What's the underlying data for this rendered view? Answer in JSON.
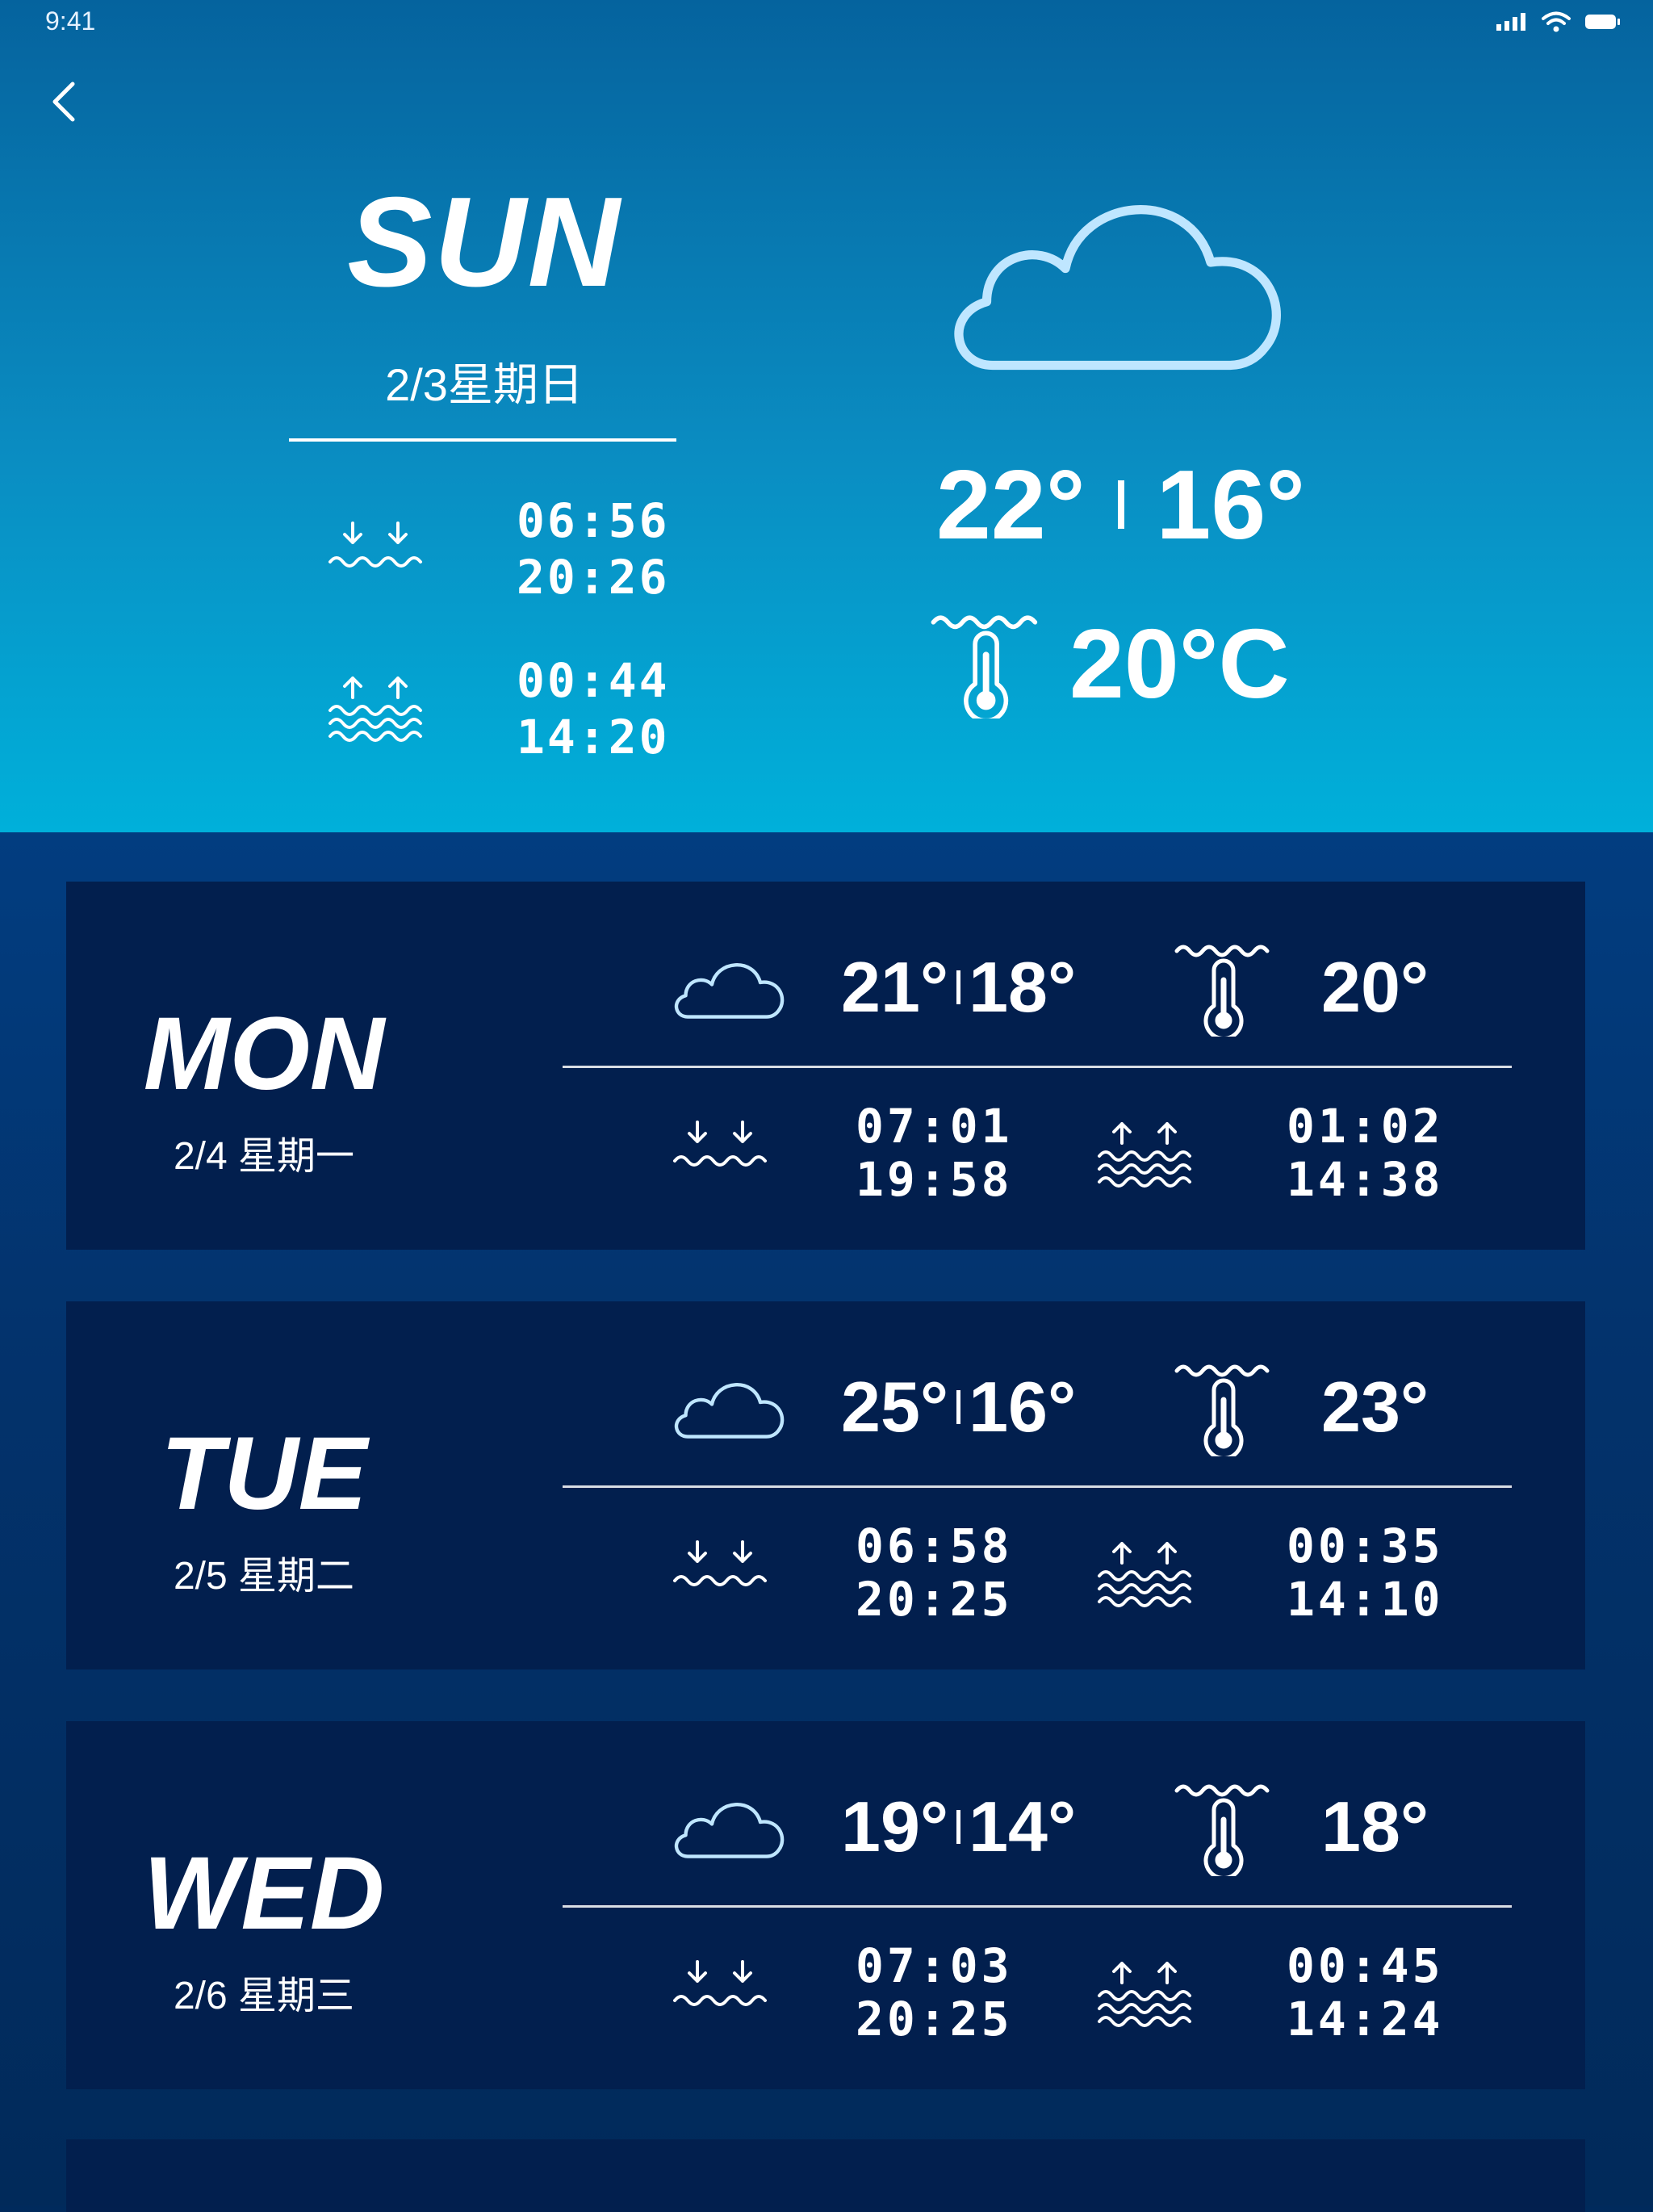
{
  "status_bar": {
    "time": "9:41"
  },
  "today": {
    "day": "SUN",
    "date": "2/3星期日",
    "low_tide_times": [
      "06:56",
      "20:26"
    ],
    "high_tide_times": [
      "00:44",
      "14:20"
    ],
    "weather_icon": "cloud-icon",
    "temp_high": "22°",
    "temp_low": "16°",
    "water_temp": "20°C"
  },
  "forecast": [
    {
      "day": "MON",
      "date": "2/4 星期一",
      "temp_high": "21°",
      "temp_low": "18°",
      "water_temp": "20°",
      "low_tide_times": [
        "07:01",
        "19:58"
      ],
      "high_tide_times": [
        "01:02",
        "14:38"
      ]
    },
    {
      "day": "TUE",
      "date": "2/5 星期二",
      "temp_high": "25°",
      "temp_low": "16°",
      "water_temp": "23°",
      "low_tide_times": [
        "06:58",
        "20:25"
      ],
      "high_tide_times": [
        "00:35",
        "14:10"
      ]
    },
    {
      "day": "WED",
      "date": "2/6 星期三",
      "temp_high": "19°",
      "temp_low": "14°",
      "water_temp": "18°",
      "low_tide_times": [
        "07:03",
        "20:25"
      ],
      "high_tide_times": [
        "00:45",
        "14:24"
      ]
    }
  ],
  "colors": {
    "hero_top": "#05639e",
    "hero_bottom": "#00b0da",
    "card_bg": "#021f4e",
    "page_bg": "#023d80",
    "cloud_stroke": "#bfe6ff"
  }
}
